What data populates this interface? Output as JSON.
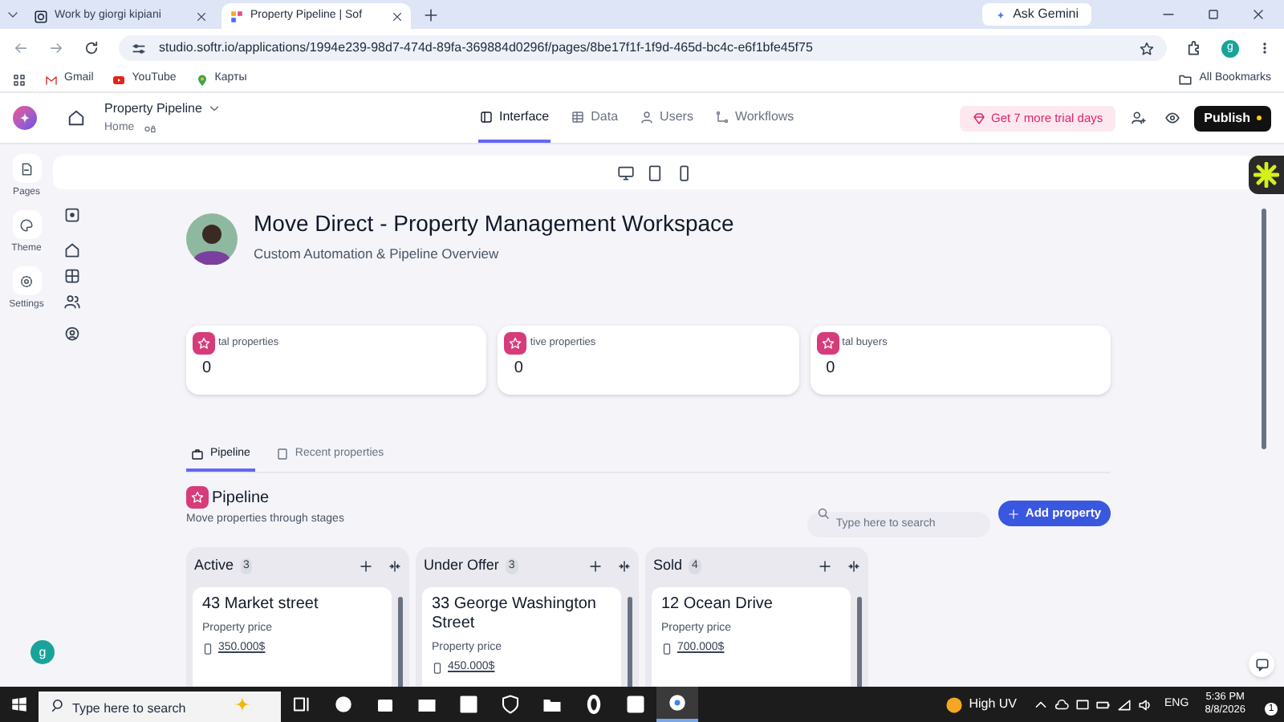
{
  "browser": {
    "tabs": [
      {
        "title": "Work by giorgi kipiani",
        "selected": false
      },
      {
        "title": "Property Pipeline | Sof",
        "selected": true
      }
    ],
    "gemini": "Ask Gemini",
    "url": "studio.softr.io/applications/1994e239-98d7-474d-89fa-369884d0296f/pages/8be17f1f-1f9d-465d-bc4c-e6f1bfe45f75",
    "profile": "g",
    "bookmarks": [
      "Gmail",
      "YouTube",
      "Карты"
    ],
    "all_bookmarks": "All Bookmarks"
  },
  "app_header": {
    "app_name": "Property Pipeline",
    "page": "Home",
    "nav": [
      {
        "label": "Interface",
        "selected": true
      },
      {
        "label": "Data",
        "selected": false
      },
      {
        "label": "Users",
        "selected": false
      },
      {
        "label": "Workflows",
        "selected": false
      }
    ],
    "trial": "Get 7 more trial days",
    "publish": "Publish"
  },
  "rail": [
    "Pages",
    "Theme",
    "Settings"
  ],
  "user_initial": "g",
  "page": {
    "title": "Move Direct - Property Management Workspace",
    "subtitle": "Custom Automation & Pipeline Overview",
    "stats": [
      {
        "label": "tal properties",
        "value": "0"
      },
      {
        "label": "tive properties",
        "value": "0"
      },
      {
        "label": "tal buyers",
        "value": "0"
      }
    ],
    "tabs": [
      {
        "label": "Pipeline",
        "selected": true
      },
      {
        "label": "Recent properties",
        "selected": false
      }
    ],
    "pipeline": {
      "title": "Pipeline",
      "subtitle": "Move properties through stages",
      "search_placeholder": "Type here to search",
      "add": "Add property",
      "columns": [
        {
          "name": "Active",
          "count": "3",
          "cards": [
            {
              "title": "43 Market street",
              "label": "Property price",
              "price": "350.000$"
            }
          ]
        },
        {
          "name": "Under Offer",
          "count": "3",
          "cards": [
            {
              "title": "33 George Washington Street",
              "label": "Property price",
              "price": "450.000$"
            }
          ]
        },
        {
          "name": "Sold",
          "count": "4",
          "cards": [
            {
              "title": "12 Ocean Drive",
              "label": "Property price",
              "price": "700.000$"
            }
          ]
        }
      ]
    }
  },
  "taskbar": {
    "search_placeholder": "Type here to search",
    "weather": "High UV",
    "lang": "ENG",
    "time": "5:36 PM",
    "date": "8/8/2026",
    "notifications": "1"
  }
}
